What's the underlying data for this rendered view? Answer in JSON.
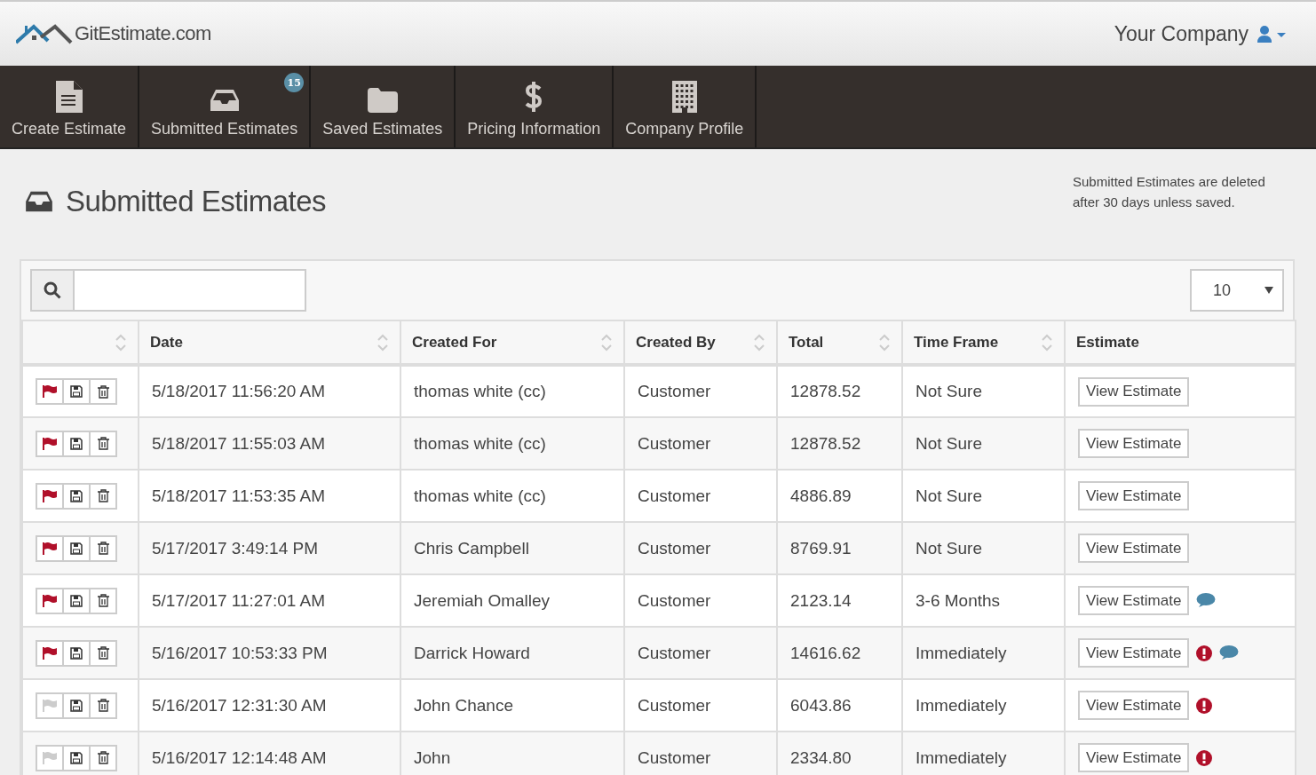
{
  "header": {
    "logo_text": "GitEstimate.com",
    "company": "Your Company"
  },
  "nav": [
    {
      "label": "Create Estimate",
      "kind": "document"
    },
    {
      "label": "Submitted Estimates",
      "kind": "inbox",
      "badge": "15"
    },
    {
      "label": "Saved Estimates",
      "kind": "folder"
    },
    {
      "label": "Pricing Information",
      "kind": "dollar"
    },
    {
      "label": "Company Profile",
      "kind": "building"
    }
  ],
  "page": {
    "title": "Submitted Estimates",
    "notice": "Submitted Estimates are deleted after 30 days unless saved."
  },
  "page_size": "10",
  "table": {
    "columns": [
      {
        "sortable": true
      },
      {
        "label": "Date",
        "sortable": true
      },
      {
        "label": "Created For",
        "sortable": true
      },
      {
        "label": "Created By",
        "sortable": true
      },
      {
        "label": "Total",
        "sortable": true
      },
      {
        "label": "Time Frame",
        "sortable": true
      },
      {
        "label": "Estimate",
        "sortable": false
      }
    ],
    "rows": [
      {
        "flagged": true,
        "date": "5/18/2017 11:56:20 AM",
        "created_for": "thomas white (cc)",
        "created_by": "Customer",
        "total": "12878.52",
        "time_frame": "Not Sure",
        "button": "View Estimate",
        "alert": false,
        "comment": false
      },
      {
        "flagged": true,
        "date": "5/18/2017 11:55:03 AM",
        "created_for": "thomas white (cc)",
        "created_by": "Customer",
        "total": "12878.52",
        "time_frame": "Not Sure",
        "button": "View Estimate",
        "alert": false,
        "comment": false
      },
      {
        "flagged": true,
        "date": "5/18/2017 11:53:35 AM",
        "created_for": "thomas white (cc)",
        "created_by": "Customer",
        "total": "4886.89",
        "time_frame": "Not Sure",
        "button": "View Estimate",
        "alert": false,
        "comment": false
      },
      {
        "flagged": true,
        "date": "5/17/2017 3:49:14 PM",
        "created_for": "Chris Campbell",
        "created_by": "Customer",
        "total": "8769.91",
        "time_frame": "Not Sure",
        "button": "View Estimate",
        "alert": false,
        "comment": false
      },
      {
        "flagged": true,
        "date": "5/17/2017 11:27:01 AM",
        "created_for": "Jeremiah Omalley",
        "created_by": "Customer",
        "total": "2123.14",
        "time_frame": "3-6 Months",
        "button": "View Estimate",
        "alert": false,
        "comment": true
      },
      {
        "flagged": true,
        "date": "5/16/2017 10:53:33 PM",
        "created_for": "Darrick Howard",
        "created_by": "Customer",
        "total": "14616.62",
        "time_frame": "Immediately",
        "button": "View Estimate",
        "alert": true,
        "comment": true
      },
      {
        "flagged": false,
        "date": "5/16/2017 12:31:30 AM",
        "created_for": "John Chance",
        "created_by": "Customer",
        "total": "6043.86",
        "time_frame": "Immediately",
        "button": "View Estimate",
        "alert": true,
        "comment": false
      },
      {
        "flagged": false,
        "date": "5/16/2017 12:14:48 AM",
        "created_for": "John",
        "created_by": "Customer",
        "total": "2334.80",
        "time_frame": "Immediately",
        "button": "View Estimate",
        "alert": true,
        "comment": false
      }
    ]
  }
}
